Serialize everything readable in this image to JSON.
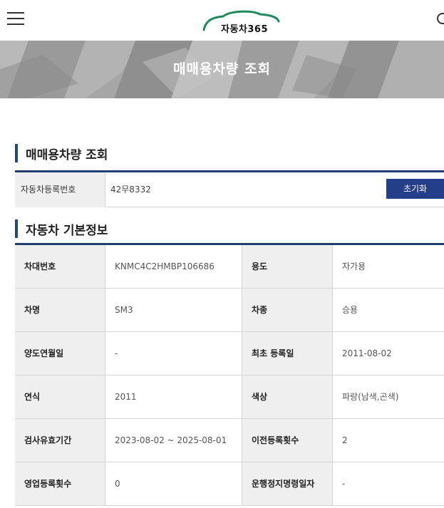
{
  "header": {
    "logo_text": "자동차365",
    "menu_icon": "hamburger-menu-icon",
    "search_icon": "search-icon"
  },
  "banner": {
    "title": "매매용차량 조회"
  },
  "lookup": {
    "heading": "매매용차량 조회",
    "label": "자동차등록번호",
    "value": "42무8332",
    "reset_label": "초기화"
  },
  "basic_info": {
    "heading": "자동차 기본정보",
    "rows": [
      {
        "l1": "차대번호",
        "v1": "KNMC4C2HMBP106686",
        "l2": "용도",
        "v2": "자가용"
      },
      {
        "l1": "차명",
        "v1": "SM3",
        "l2": "차종",
        "v2": "승용"
      },
      {
        "l1": "양도연월일",
        "v1": "-",
        "l2": "최초 등록일",
        "v2": "2011-08-02"
      },
      {
        "l1": "연식",
        "v1": "2011",
        "l2": "색상",
        "v2": "파랑(남색,곤색)"
      },
      {
        "l1": "검사유효기간",
        "v1": "2023-08-02 ~ 2025-08-01",
        "l2": "이전등록횟수",
        "v2": "2"
      },
      {
        "l1": "영업등록횟수",
        "v1": "0",
        "l2": "운행정지명령일자",
        "v2": "-"
      }
    ]
  },
  "colors": {
    "accent": "#1e4a80",
    "button": "#243f8a",
    "logo_green": "#1f8a5a"
  }
}
